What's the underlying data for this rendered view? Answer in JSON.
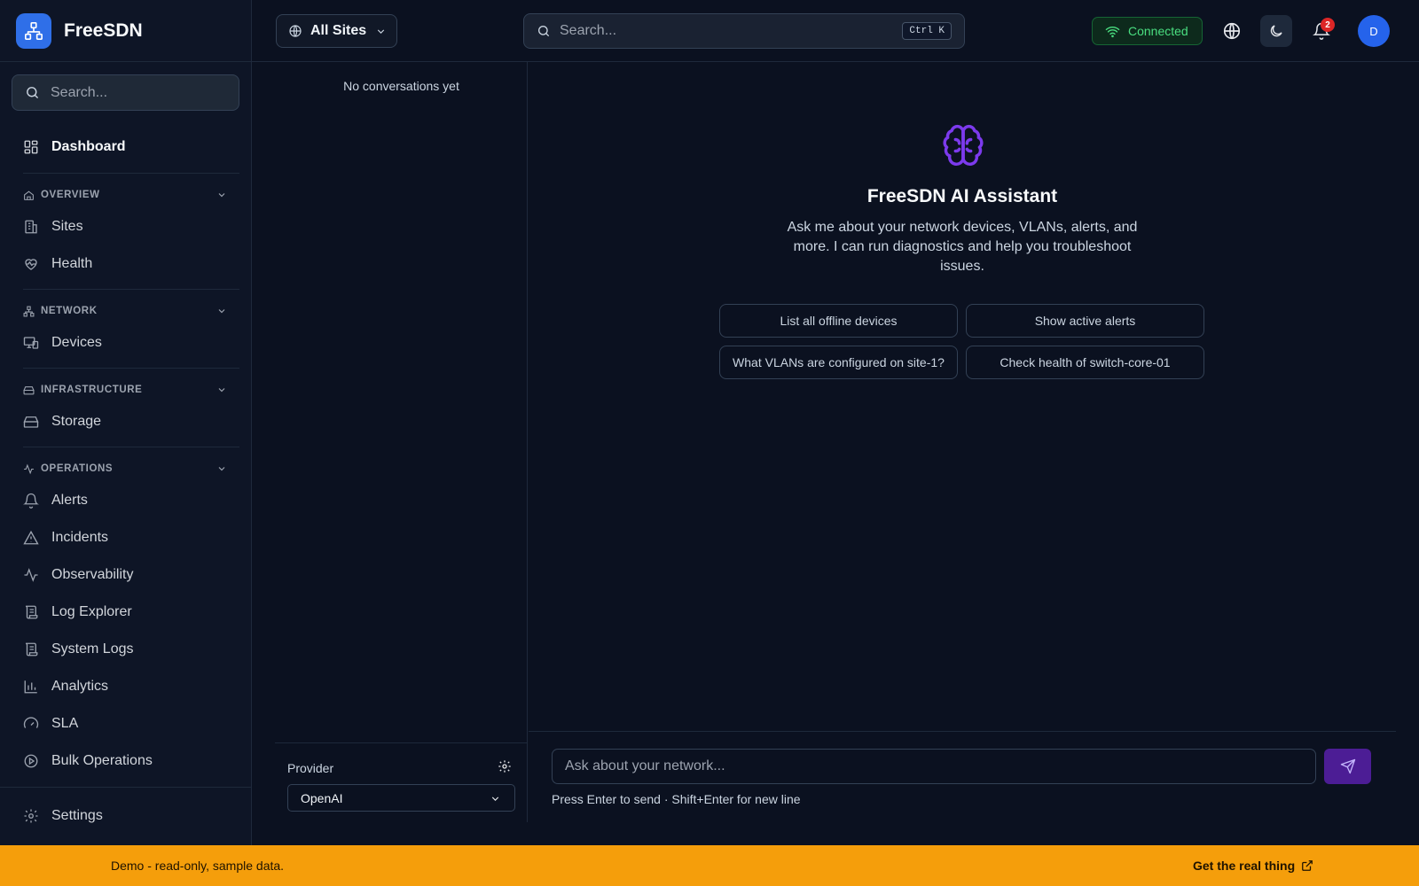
{
  "app": {
    "name": "FreeSDN"
  },
  "sidebar": {
    "search_placeholder": "Search...",
    "dashboard": "Dashboard",
    "sections": {
      "overview": "OVERVIEW",
      "network": "NETWORK",
      "infrastructure": "INFRASTRUCTURE",
      "operations": "OPERATIONS"
    },
    "items": {
      "sites": "Sites",
      "health": "Health",
      "devices": "Devices",
      "storage": "Storage",
      "alerts": "Alerts",
      "incidents": "Incidents",
      "observability": "Observability",
      "log_explorer": "Log Explorer",
      "system_logs": "System Logs",
      "analytics": "Analytics",
      "sla": "SLA",
      "bulk_operations": "Bulk Operations"
    },
    "settings": "Settings"
  },
  "topbar": {
    "site_selector": "All Sites",
    "search_placeholder": "Search...",
    "shortcut": "Ctrl K",
    "status": "Connected",
    "notification_count": "2",
    "avatar_initial": "D"
  },
  "conversations": {
    "empty_text": "No conversations yet",
    "provider_label": "Provider",
    "provider_value": "OpenAI"
  },
  "assistant": {
    "title": "FreeSDN AI Assistant",
    "description": "Ask me about your network devices, VLANs, alerts, and more. I can run diagnostics and help you troubleshoot issues.",
    "suggestions": [
      "List all offline devices",
      "Show active alerts",
      "What VLANs are configured on site-1?",
      "Check health of switch-core-01"
    ],
    "input_placeholder": "Ask about your network...",
    "hint": "Press Enter to send · Shift+Enter for new line"
  },
  "banner": {
    "text": "Demo - read-only, sample data.",
    "link": "Get the real thing"
  },
  "colors": {
    "background": "#0b1120",
    "accent": "#2f6fe8",
    "assistant_purple": "#7c3aed",
    "status_green": "#4ade80",
    "banner": "#f59e0b",
    "badge_red": "#dc2626"
  }
}
